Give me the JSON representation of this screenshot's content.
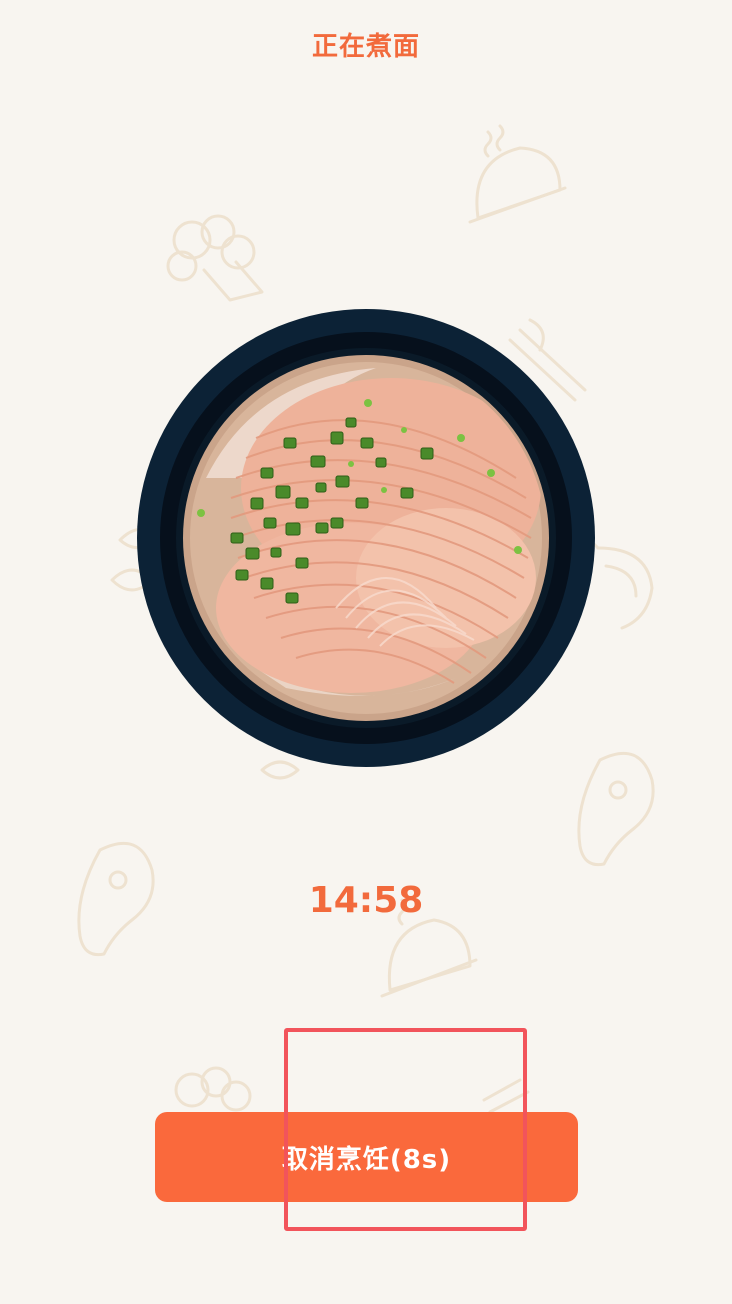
{
  "header": {
    "title": "正在煮面"
  },
  "status": {
    "timer": "14:58"
  },
  "actions": {
    "cancel_label": "取消烹饪(8s)"
  },
  "colors": {
    "accent": "#fa693c",
    "text_accent": "#f26a3c",
    "background": "#f8f5f0",
    "highlight": "#f2545b"
  },
  "icons": {
    "background": [
      "cloche-icon",
      "broccoli-icon",
      "knife-fork-icon",
      "shrimp-icon",
      "steak-icon",
      "leaf-icon"
    ],
    "main": "noodle-bowl-icon"
  }
}
